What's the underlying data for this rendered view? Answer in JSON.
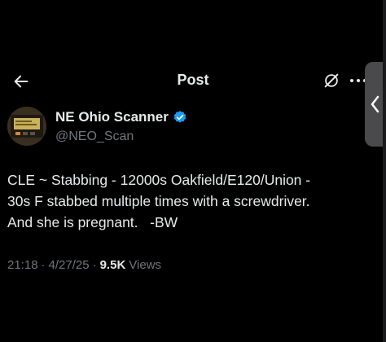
{
  "header": {
    "title": "Post",
    "back_icon": "arrow-left-icon",
    "grok_icon": "grok-icon",
    "more_icon": "more-horizontal-icon"
  },
  "side_tab": {
    "icon": "chevron-left-icon"
  },
  "author": {
    "name": "NE Ohio Scanner",
    "handle": "@NEO_Scan",
    "verified_color": "#1d9bf0"
  },
  "tweet": {
    "text": "CLE ~ Stabbing - 12000s Oakfield/E120/Union -\n30s F stabbed multiple times with a screwdriver.\nAnd she is pregnant.   -BW",
    "time": "21:18",
    "date": "4/27/25",
    "views_count": "9.5K",
    "views_label": "Views"
  },
  "colors": {
    "background": "#000000",
    "text_primary": "#e7e9ea",
    "text_secondary": "#71767b",
    "side_tab": "#4a4a4c"
  }
}
